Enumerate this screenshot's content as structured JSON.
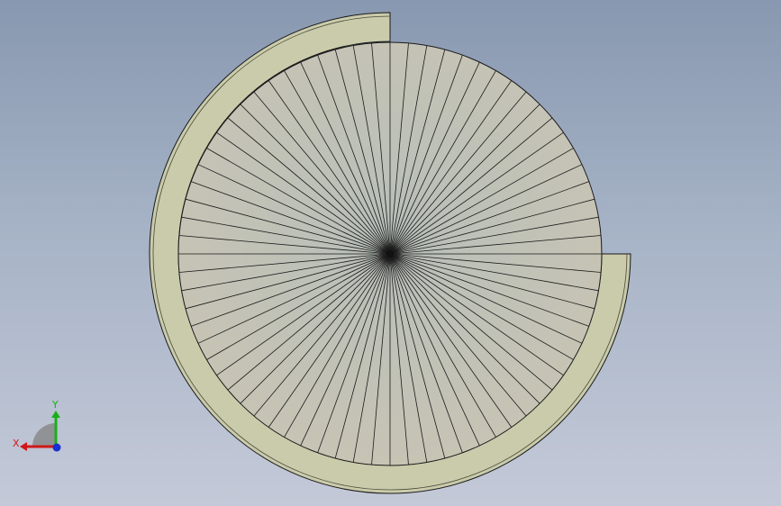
{
  "viewport": {
    "background_top": "#8898b0",
    "background_bottom": "#c4c9d8"
  },
  "model": {
    "face_fill": "#c2c5b0",
    "flange_fill": "#c9cbab",
    "edge_color": "#1a1a1a",
    "radial_segment_count": 72
  },
  "triad": {
    "x_label": "X",
    "y_label": "Y",
    "x_color": "#d01818",
    "y_color": "#18b018",
    "z_color": "#1830d0"
  }
}
